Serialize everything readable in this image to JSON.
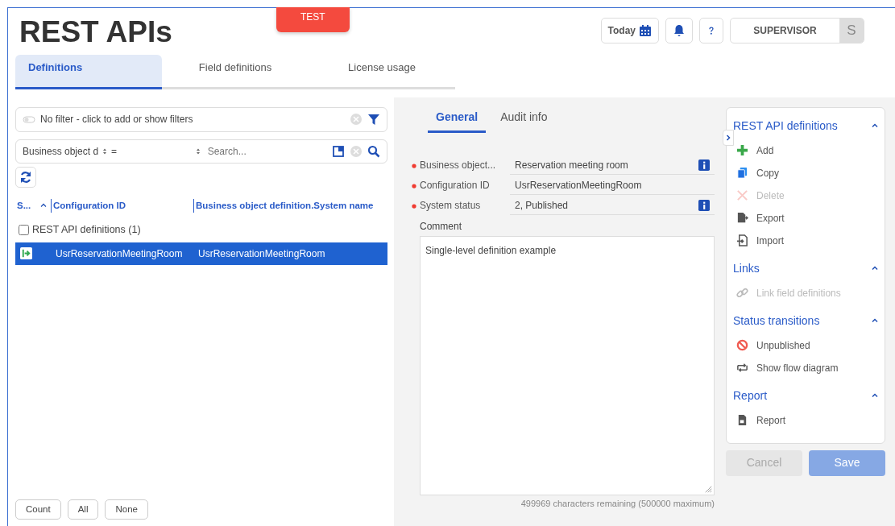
{
  "environment_badge": "TEST",
  "title": "REST APIs",
  "header": {
    "today_button": "Today",
    "user": "SUPERVISOR",
    "avatar": "S"
  },
  "tabs": [
    {
      "label": "Definitions",
      "selected": true
    },
    {
      "label": "Field definitions",
      "selected": false
    },
    {
      "label": "License usage",
      "selected": false
    }
  ],
  "filter": {
    "placeholder": "No filter - click to add or show filters"
  },
  "search": {
    "field": "Business object d",
    "operator": "=",
    "placeholder": "Search..."
  },
  "table": {
    "columns": [
      "S...",
      "Configuration ID",
      "Business object definition.System name"
    ],
    "group": {
      "label": "REST API definitions (1)",
      "checked": false
    },
    "rows": [
      {
        "cells": [
          "",
          "UsrReservationMeetingRoom",
          "UsrReservationMeetingRoom"
        ],
        "selected": true
      }
    ]
  },
  "list_buttons": [
    "Count",
    "All",
    "None"
  ],
  "detail": {
    "tabs": [
      {
        "label": "General",
        "selected": true
      },
      {
        "label": "Audit info",
        "selected": false
      }
    ],
    "fields": [
      {
        "label": "Business object...",
        "value": "Reservation meeting room",
        "required": true,
        "info": true
      },
      {
        "label": "Configuration ID",
        "value": "UsrReservationMeetingRoom",
        "required": true,
        "info": false
      },
      {
        "label": "System status",
        "value": "2, Published",
        "required": true,
        "info": true
      }
    ],
    "comment": {
      "label": "Comment",
      "value": "Single-level definition example",
      "counter": "499969 characters remaining (500000 maximum)"
    }
  },
  "actions": [
    {
      "title": "REST API definitions",
      "expanded": true,
      "items": [
        {
          "kind": "add",
          "label": "Add",
          "disabled": false
        },
        {
          "kind": "copy",
          "label": "Copy",
          "disabled": false
        },
        {
          "kind": "delete",
          "label": "Delete",
          "disabled": true
        },
        {
          "kind": "export",
          "label": "Export",
          "disabled": false
        },
        {
          "kind": "import",
          "label": "Import",
          "disabled": false
        }
      ]
    },
    {
      "title": "Links",
      "expanded": true,
      "items": [
        {
          "kind": "link",
          "label": "Link field definitions",
          "disabled": true
        }
      ]
    },
    {
      "title": "Status transitions",
      "expanded": true,
      "items": [
        {
          "kind": "unpublish",
          "label": "Unpublished",
          "disabled": false
        },
        {
          "kind": "flow",
          "label": "Show flow diagram",
          "disabled": false
        }
      ]
    },
    {
      "title": "Report",
      "expanded": true,
      "items": [
        {
          "kind": "report",
          "label": "Report",
          "disabled": false
        }
      ]
    }
  ],
  "form_buttons": [
    {
      "label": "Cancel",
      "kind": "cancel",
      "disabled": true
    },
    {
      "label": "Save",
      "kind": "save",
      "disabled": true
    }
  ]
}
